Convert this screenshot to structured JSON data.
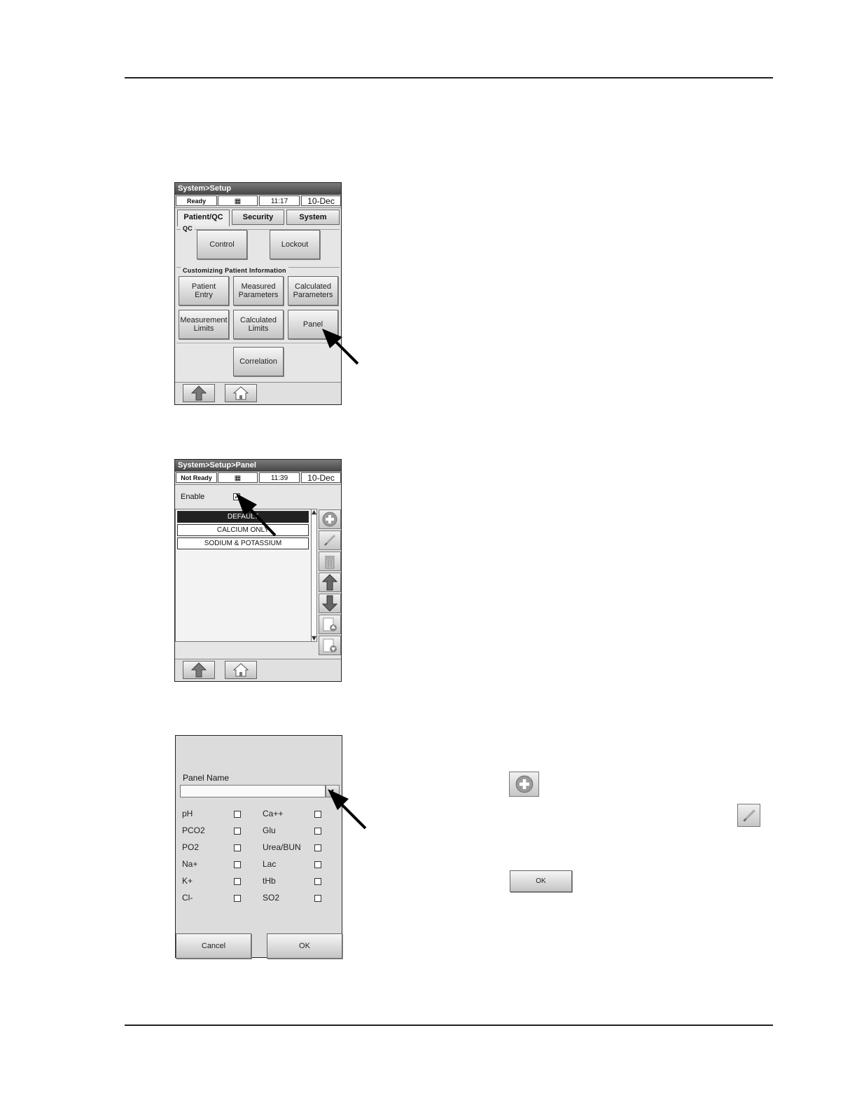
{
  "screen1": {
    "title": "System>Setup",
    "status": {
      "state": "Ready",
      "time": "11:17",
      "date": "10-Dec"
    },
    "tabs": [
      "Patient/QC",
      "Security",
      "System"
    ],
    "qc_label": "QC",
    "qc_buttons": {
      "control": "Control",
      "lockout": "Lockout"
    },
    "custom_label": "Customizing Patient Information",
    "buttons": {
      "patient_entry": "Patient\nEntry",
      "measured_parameters": "Measured\nParameters",
      "calculated_parameters": "Calculated\nParameters",
      "measurement_limits": "Measurement\nLimits",
      "calculated_limits": "Calculated\nLimits",
      "panel": "Panel",
      "correlation": "Correlation"
    }
  },
  "screen2": {
    "title": "System>Setup>Panel",
    "status": {
      "state": "Not Ready",
      "time": "11:39",
      "date": "10-Dec"
    },
    "enable_label": "Enable",
    "enable_checked": true,
    "panels": [
      "DEFAULT",
      "CALCIUM ONLY",
      "SODIUM & POTASSIUM"
    ]
  },
  "screen3": {
    "panel_name_label": "Panel Name",
    "panel_name_value": "",
    "params_left": [
      "pH",
      "PCO2",
      "PO2",
      "Na+",
      "K+",
      "Cl-"
    ],
    "params_right": [
      "Ca++",
      "Glu",
      "Urea/BUN",
      "Lac",
      "tHb",
      "SO2"
    ],
    "cancel": "Cancel",
    "ok": "OK"
  },
  "inline_ok": "OK",
  "icons": [
    "plus-icon",
    "pencil-icon",
    "trash-icon",
    "arrow-up-icon",
    "arrow-down-icon",
    "page-up-icon",
    "page-down-icon",
    "home-icon"
  ]
}
